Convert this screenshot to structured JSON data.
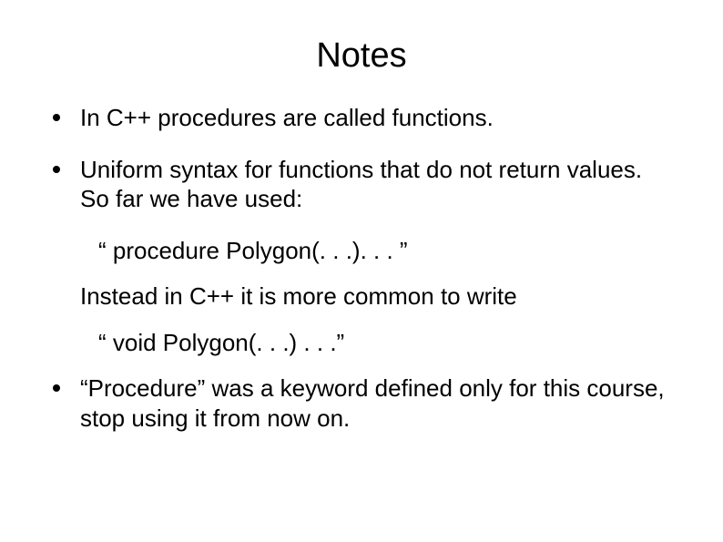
{
  "title": "Notes",
  "bullets": {
    "b1": "In C++ procedures are called functions.",
    "b2": "Uniform syntax for functions that do not return values.  So far we have used:",
    "b3": "“Procedure” was a keyword defined only for this course, stop using it from now on."
  },
  "lines": {
    "l1": "“  procedure Polygon(. . .). . . ”",
    "l2": "Instead in C++ it is more common to write",
    "l3": "“ void Polygon(. . .) . . .”"
  }
}
